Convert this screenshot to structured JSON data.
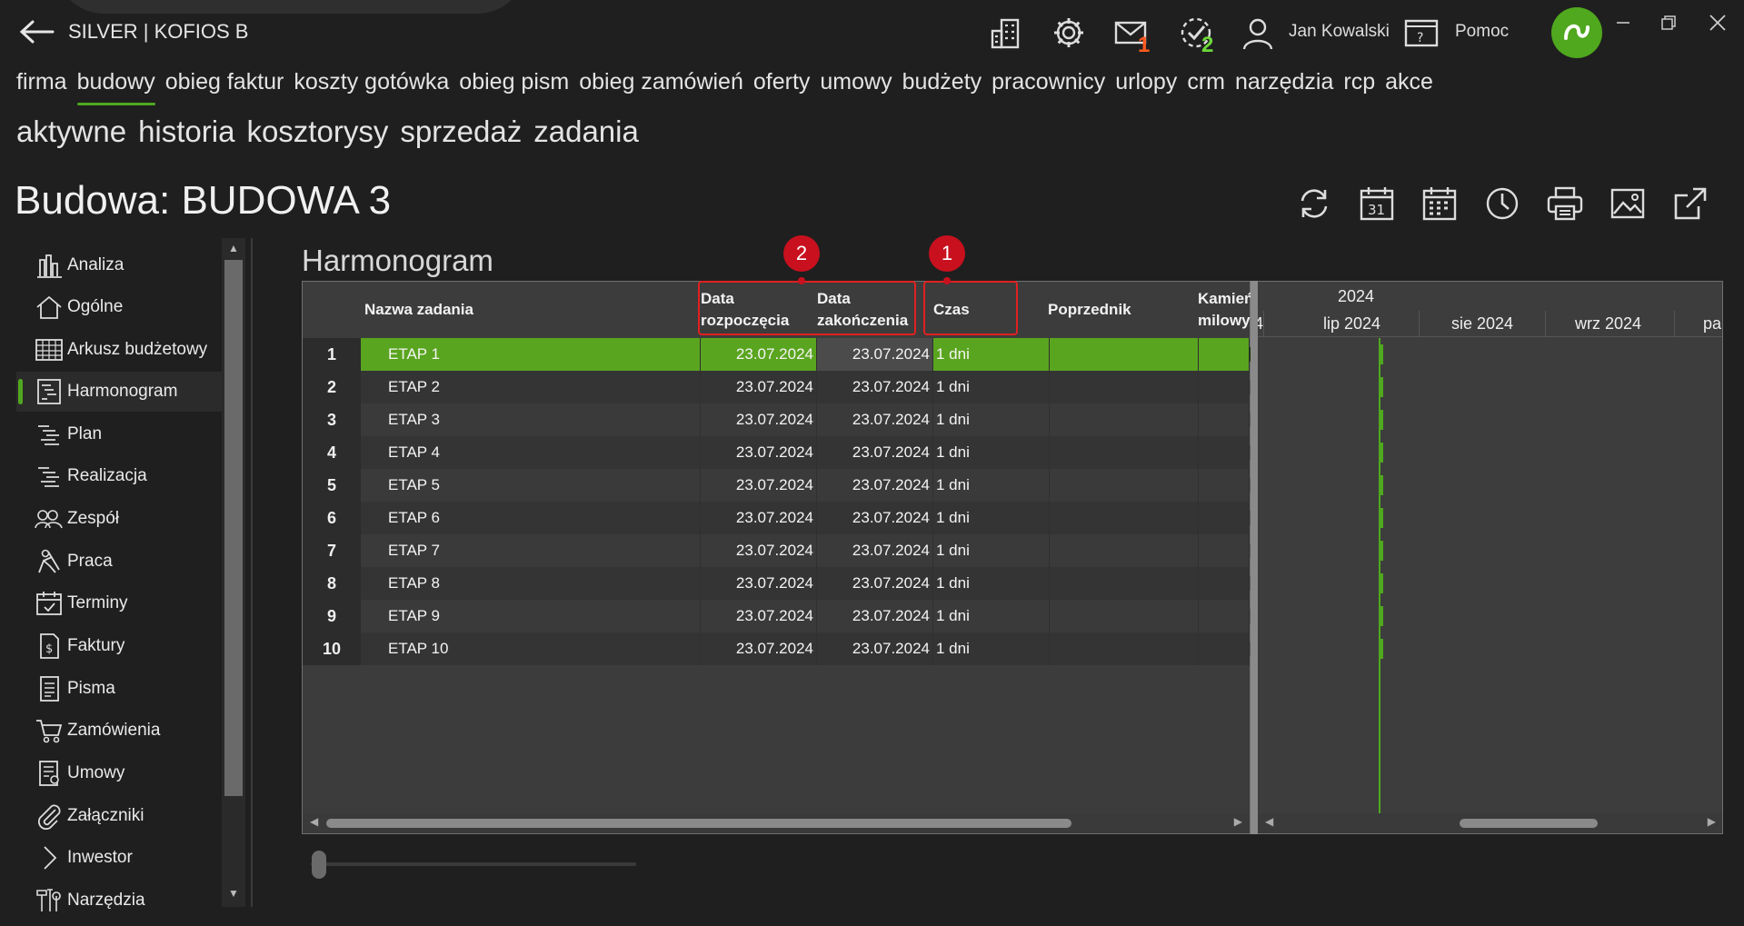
{
  "app": {
    "title": "SILVER | KOFIOS B",
    "mail_count": "1",
    "tasks_count": "2",
    "user_name": "Jan Kowalski",
    "help_label": "Pomoc"
  },
  "colors": {
    "accent": "#4fa81e",
    "mail_badge": "#ff5a1f",
    "tasks_badge": "#6dd83a",
    "annotation": "#e02020"
  },
  "main_nav": [
    {
      "label": "firma"
    },
    {
      "label": "budowy",
      "active": true
    },
    {
      "label": "obieg faktur"
    },
    {
      "label": "koszty gotówka"
    },
    {
      "label": "obieg pism"
    },
    {
      "label": "obieg zamówień"
    },
    {
      "label": "oferty"
    },
    {
      "label": "umowy"
    },
    {
      "label": "budżety"
    },
    {
      "label": "pracownicy"
    },
    {
      "label": "urlopy"
    },
    {
      "label": "crm"
    },
    {
      "label": "narzędzia"
    },
    {
      "label": "rcp"
    },
    {
      "label": "akce"
    }
  ],
  "sub_nav": [
    {
      "label": "aktywne"
    },
    {
      "label": "historia"
    },
    {
      "label": "kosztorysy"
    },
    {
      "label": "sprzedaż"
    },
    {
      "label": "zadania"
    }
  ],
  "page_title": "Budowa: BUDOWA 3",
  "actions": [
    {
      "icon": "refresh-icon"
    },
    {
      "icon": "calendar-31-icon"
    },
    {
      "icon": "calendar-grid-icon"
    },
    {
      "icon": "clock-icon"
    },
    {
      "icon": "printer-icon"
    },
    {
      "icon": "image-icon"
    },
    {
      "icon": "export-icon"
    }
  ],
  "sidebar": {
    "items": [
      {
        "label": "Analiza",
        "icon": "bar-chart-icon"
      },
      {
        "label": "Ogólne",
        "icon": "home-icon"
      },
      {
        "label": "Arkusz budżetowy",
        "icon": "spreadsheet-icon"
      },
      {
        "label": "Harmonogram",
        "icon": "schedule-icon",
        "active": true
      },
      {
        "label": "Plan",
        "icon": "plan-icon"
      },
      {
        "label": "Realizacja",
        "icon": "realization-icon"
      },
      {
        "label": "Zespół",
        "icon": "team-icon"
      },
      {
        "label": "Praca",
        "icon": "worker-icon"
      },
      {
        "label": "Terminy",
        "icon": "calendar-check-icon"
      },
      {
        "label": "Faktury",
        "icon": "invoice-icon"
      },
      {
        "label": "Pisma",
        "icon": "document-icon"
      },
      {
        "label": "Zamówienia",
        "icon": "cart-icon"
      },
      {
        "label": "Umowy",
        "icon": "contract-icon"
      },
      {
        "label": "Załączniki",
        "icon": "paperclip-icon"
      },
      {
        "label": "Inwestor",
        "icon": "chevron-right-icon"
      },
      {
        "label": "Narzędzia",
        "icon": "tools-icon"
      }
    ]
  },
  "section_title": "Harmonogram",
  "grid": {
    "columns": {
      "name": "Nazwa zadania",
      "start_l1": "Data",
      "start_l2": "rozpoczęcia",
      "end_l1": "Data",
      "end_l2": "zakończenia",
      "duration": "Czas",
      "predecessor": "Poprzednik",
      "milestone_l1": "Kamień",
      "milestone_l2": "milowy"
    },
    "rows": [
      {
        "n": "1",
        "name": "ETAP 1",
        "start": "23.07.2024",
        "end": "23.07.2024",
        "duration": "1 dni"
      },
      {
        "n": "2",
        "name": "ETAP 2",
        "start": "23.07.2024",
        "end": "23.07.2024",
        "duration": "1 dni"
      },
      {
        "n": "3",
        "name": "ETAP 3",
        "start": "23.07.2024",
        "end": "23.07.2024",
        "duration": "1 dni"
      },
      {
        "n": "4",
        "name": "ETAP 4",
        "start": "23.07.2024",
        "end": "23.07.2024",
        "duration": "1 dni"
      },
      {
        "n": "5",
        "name": "ETAP 5",
        "start": "23.07.2024",
        "end": "23.07.2024",
        "duration": "1 dni"
      },
      {
        "n": "6",
        "name": "ETAP 6",
        "start": "23.07.2024",
        "end": "23.07.2024",
        "duration": "1 dni"
      },
      {
        "n": "7",
        "name": "ETAP 7",
        "start": "23.07.2024",
        "end": "23.07.2024",
        "duration": "1 dni"
      },
      {
        "n": "8",
        "name": "ETAP 8",
        "start": "23.07.2024",
        "end": "23.07.2024",
        "duration": "1 dni"
      },
      {
        "n": "9",
        "name": "ETAP 9",
        "start": "23.07.2024",
        "end": "23.07.2024",
        "duration": "1 dni"
      },
      {
        "n": "10",
        "name": "ETAP 10",
        "start": "23.07.2024",
        "end": "23.07.2024",
        "duration": "1 dni"
      }
    ]
  },
  "gantt": {
    "year": "2024",
    "months": [
      {
        "label": "4"
      },
      {
        "label": "lip 2024"
      },
      {
        "label": "sie 2024"
      },
      {
        "label": "wrz 2024"
      },
      {
        "label": "pa"
      }
    ]
  },
  "annotations": [
    {
      "number": "1"
    },
    {
      "number": "2"
    }
  ]
}
